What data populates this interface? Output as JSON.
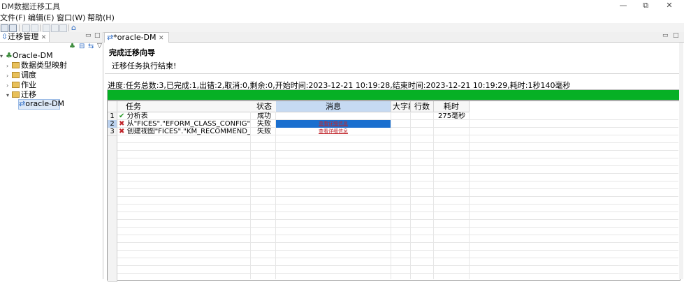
{
  "window": {
    "title": "DM数据迁移工具",
    "controls": [
      "—",
      "⧉",
      "✕"
    ]
  },
  "menu": [
    "文件(F)",
    "编辑(E)",
    "窗口(W)",
    "帮助(H)"
  ],
  "left_panel": {
    "tab_label": "迁移管理",
    "tree": [
      {
        "label": "Oracle-DM",
        "level": 0,
        "expanded": true
      },
      {
        "label": "数据类型映射",
        "level": 1
      },
      {
        "label": "调度",
        "level": 1
      },
      {
        "label": "作业",
        "level": 1
      },
      {
        "label": "迁移",
        "level": 1,
        "expanded": true
      },
      {
        "label": "oracle-DM",
        "level": 2,
        "selected": true
      }
    ]
  },
  "editor": {
    "tab_label": "*oracle-DM",
    "wizard_title": "完成迁移向导",
    "wizard_message": "迁移任务执行结束!",
    "progress_text": "进度:任务总数:3,已完成:1,出错:2,取消:0,剩余:0,开始时间:2023-12-21 10:19:28,结束时间:2023-12-21 10:19:29,耗时:1秒140毫秒",
    "progress_fraction": 1.0,
    "progress_color": "#06b025"
  },
  "table": {
    "columns": [
      "任务",
      "状态",
      "消息",
      "大字段",
      "行数",
      "耗时"
    ],
    "rows": [
      {
        "num": "1",
        "status_icon": "✔",
        "task": "分析表",
        "status": "成功",
        "message": "",
        "big": "",
        "rows": "",
        "time": "275毫秒"
      },
      {
        "num": "2",
        "status_icon": "✖",
        "task": "从\"FICES\".\"EFORM_CLASS_CONFIG\"迁移到",
        "status": "失败",
        "message": "查看详细信息",
        "big": "",
        "rows": "",
        "time": ""
      },
      {
        "num": "3",
        "status_icon": "✖",
        "task": "创建视图\"FICES\".\"KM_RECOMMEND_V\"",
        "status": "失败",
        "message": "查看详细信息",
        "big": "",
        "rows": "",
        "time": ""
      }
    ]
  }
}
